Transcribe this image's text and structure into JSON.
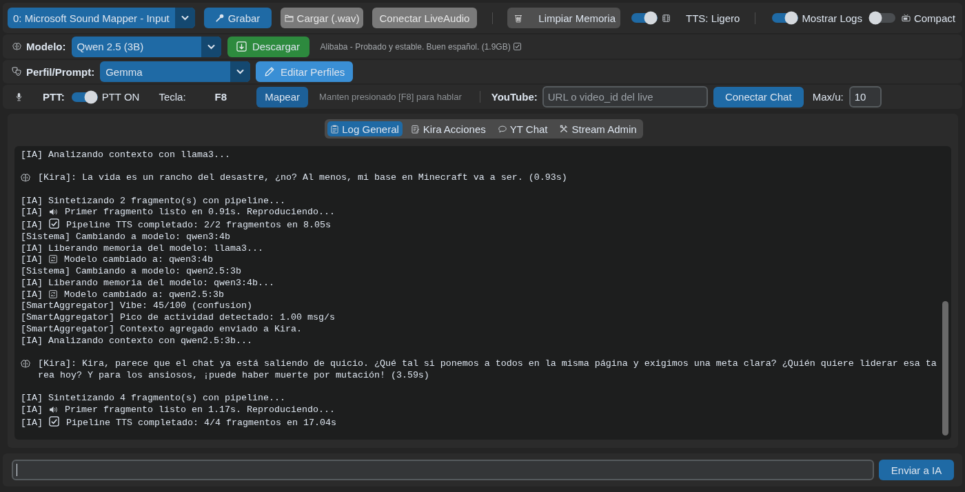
{
  "toolbar": {
    "device_select": "0: Microsoft Sound Mapper - Input",
    "record_button": "Grabar",
    "load_button": "Cargar (.wav)",
    "live_audio_button": "Conectar LiveAudio",
    "clear_memory_button": "Limpiar Memoria",
    "tts_switch": {
      "on": true,
      "label": "TTS: Ligero"
    },
    "logs_switch": {
      "on": true,
      "label": "Mostrar Logs"
    },
    "compact_switch": {
      "on": false,
      "label": "Compact"
    }
  },
  "model_row": {
    "label": "Modelo:",
    "select": "Qwen 2.5 (3B)",
    "download_button": "Descargar",
    "info": "Alibaba - Probado y estable. Buen español. (1.9GB)"
  },
  "profile_row": {
    "label": "Perfil/Prompt:",
    "select": "Gemma",
    "edit_button": "Editar Perfiles"
  },
  "ptt_row": {
    "label": "PTT:",
    "ptt_switch": {
      "on": true,
      "label": "PTT ON"
    },
    "key_label": "Tecla:",
    "key": "F8",
    "map_button": "Mapear",
    "hint": "Manten presionado [F8] para hablar",
    "youtube_label": "YouTube:",
    "youtube_field": {
      "placeholder": "URL o video_id del live"
    },
    "connect_chat_button": "Conectar Chat",
    "max_label": "Max/u:",
    "max_field": {
      "value": "10"
    }
  },
  "tabs": [
    {
      "label": "Log General",
      "kind": "log",
      "selected": true
    },
    {
      "label": "Kira Acciones",
      "kind": "actions",
      "selected": false
    },
    {
      "label": "YT Chat",
      "kind": "chat",
      "selected": false
    },
    {
      "label": "Stream Admin",
      "kind": "admin",
      "selected": false
    }
  ],
  "log": {
    "blocks": [
      {
        "lines": [
          {
            "kind": "plain",
            "text": "[IA] Analizando contexto con llama3..."
          }
        ]
      },
      {
        "lines": [
          {
            "kind": "reply",
            "text": "[Kira]: La vida es un rancho del desastre, ¿no? Al menos, mi base en Minecraft va a ser. (0.93s)"
          }
        ]
      },
      {
        "lines": [
          {
            "kind": "plain",
            "text": "[IA] Sintetizando 2 fragmento(s) con pipeline..."
          },
          {
            "kind": "playback",
            "tag": "[IA]",
            "text": "Primer fragmento listo en 0.91s. Reproduciendo..."
          },
          {
            "kind": "done",
            "tag": "[IA]",
            "text": "Pipeline TTS completado: 2/2 fragmentos en 8.05s"
          },
          {
            "kind": "plain",
            "text": "[Sistema] Cambiando a modelo: qwen3:4b"
          },
          {
            "kind": "plain",
            "text": "[IA] Liberando memoria del modelo: llama3..."
          },
          {
            "kind": "model-change",
            "tag": "[IA]",
            "text": "Modelo cambiado a: qwen3:4b"
          },
          {
            "kind": "plain",
            "text": "[Sistema] Cambiando a modelo: qwen2.5:3b"
          },
          {
            "kind": "plain",
            "text": "[IA] Liberando memoria del modelo: qwen3:4b..."
          },
          {
            "kind": "model-change",
            "tag": "[IA]",
            "text": "Modelo cambiado a: qwen2.5:3b"
          },
          {
            "kind": "plain",
            "text": "[SmartAggregator] Vibe: 45/100 (confusion)"
          },
          {
            "kind": "plain",
            "text": "[SmartAggregator] Pico de actividad detectado: 1.00 msg/s"
          },
          {
            "kind": "plain",
            "text": "[SmartAggregator] Contexto agregado enviado a Kira."
          },
          {
            "kind": "plain",
            "text": "[IA] Analizando contexto con qwen2.5:3b..."
          }
        ]
      },
      {
        "lines": [
          {
            "kind": "reply",
            "text": "[Kira]: Kira, parece que el chat ya está saliendo de quicio. ¿Qué tal si ponemos a todos en la misma página y exigimos una meta clara? ¿Quién quiere liderar esa tarea hoy? Y para los ansiosos, ¡puede haber muerte por mutación! (3.59s)"
          }
        ]
      },
      {
        "lines": [
          {
            "kind": "plain",
            "text": "[IA] Sintetizando 4 fragmento(s) con pipeline..."
          },
          {
            "kind": "playback",
            "tag": "[IA]",
            "text": "Primer fragmento listo en 1.17s. Reproduciendo..."
          },
          {
            "kind": "done",
            "tag": "[IA]",
            "text": "Pipeline TTS completado: 4/4 fragmentos en 17.04s"
          }
        ]
      }
    ]
  },
  "chat_input": {
    "send_button": "Enviar a IA"
  }
}
